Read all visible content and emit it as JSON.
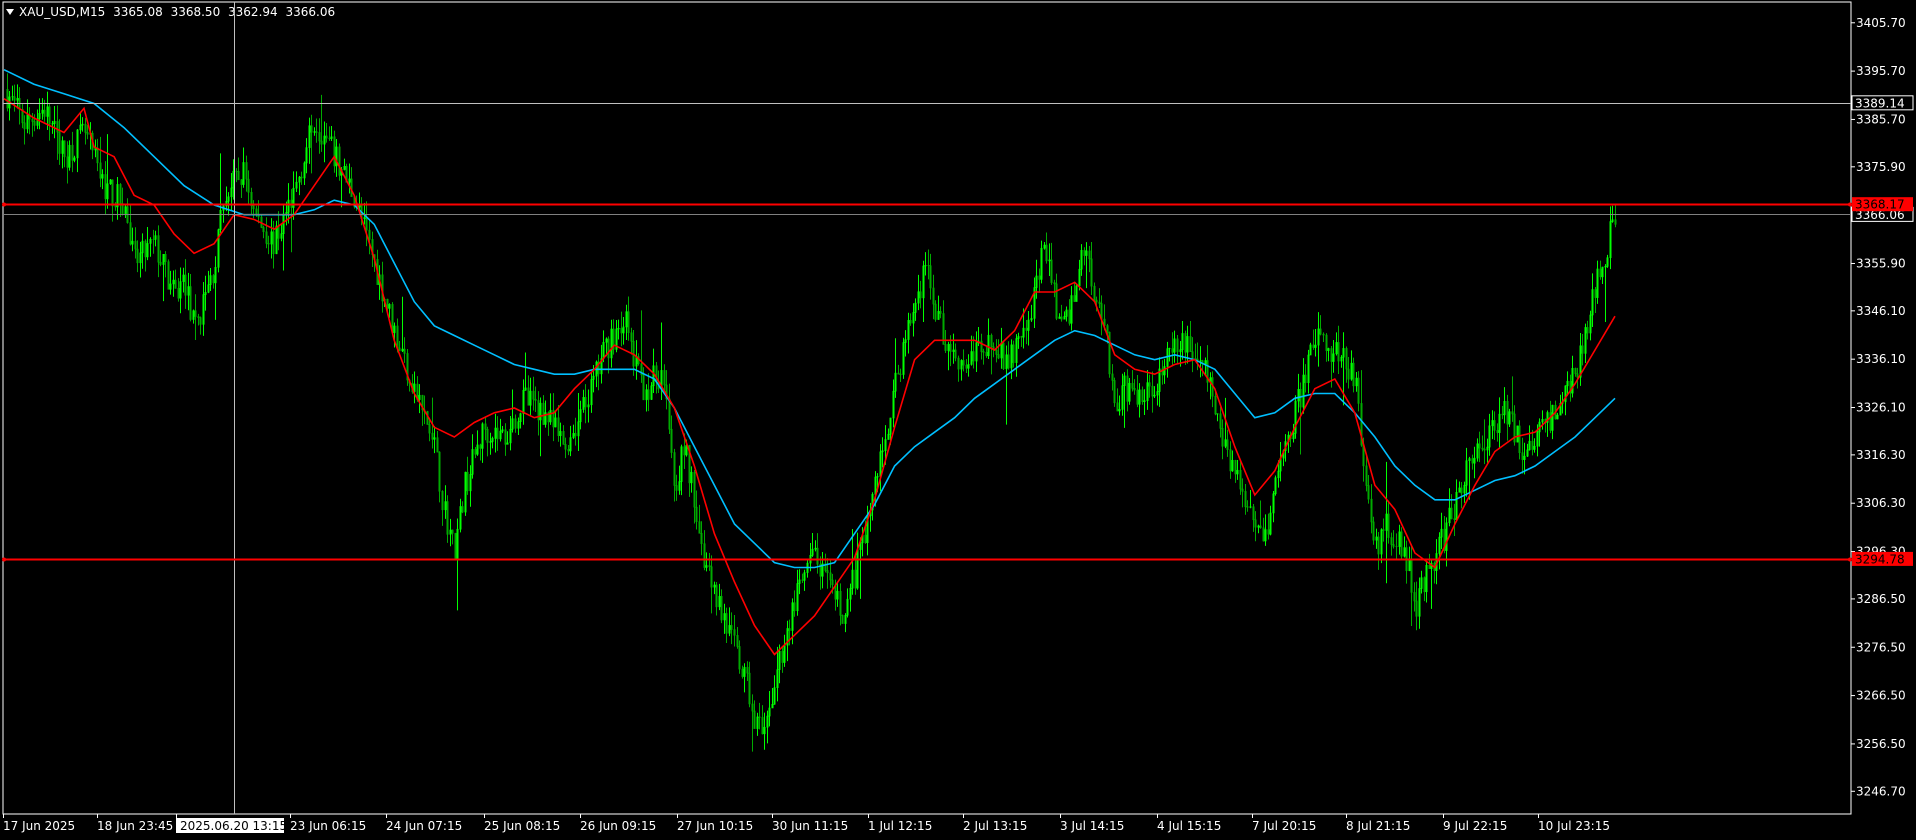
{
  "header": {
    "symbol": "XAU_USD,M15",
    "open": "3365.08",
    "high": "3368.50",
    "low": "3362.94",
    "close": "3366.06"
  },
  "colors": {
    "background": "#000000",
    "bull_candle": "#00ff00",
    "bear_candle": "#00aa00",
    "ma_fast": "#ff0000",
    "ma_slow": "#00bfff",
    "hline": "#ff0000",
    "axis": "#ffffff",
    "crosshair": "#c0c0c0"
  },
  "chart_data": {
    "type": "candlestick",
    "symbol": "XAU_USD",
    "timeframe": "M15",
    "ylim": [
      3242.0,
      3410.0
    ],
    "y_ticks": [
      "3405.70",
      "3395.70",
      "3385.70",
      "3375.90",
      "3366.10",
      "3355.90",
      "3346.10",
      "3336.10",
      "3326.10",
      "3316.30",
      "3306.30",
      "3296.30",
      "3286.50",
      "3276.50",
      "3266.50",
      "3256.50",
      "3246.70"
    ],
    "x_ticks": [
      "17 Jun 2025",
      "18 Jun 23:45",
      "2025.06.20 13:15",
      "23 Jun 06:15",
      "24 Jun 07:15",
      "25 Jun 08:15",
      "26 Jun 09:15",
      "27 Jun 10:15",
      "30 Jun 11:15",
      "1 Jul 12:15",
      "2 Jul 13:15",
      "3 Jul 14:15",
      "4 Jul 15:15",
      "7 Jul 20:15",
      "8 Jul 21:15",
      "9 Jul 22:15",
      "10 Jul 23:15"
    ],
    "price_path": [
      [
        0,
        3392
      ],
      [
        2,
        3385
      ],
      [
        4,
        3388
      ],
      [
        6,
        3378
      ],
      [
        8,
        3383
      ],
      [
        10,
        3372
      ],
      [
        12,
        3368
      ],
      [
        13,
        3356
      ],
      [
        15,
        3360
      ],
      [
        17,
        3349
      ],
      [
        18,
        3353
      ],
      [
        19,
        3342
      ],
      [
        21,
        3355
      ],
      [
        22,
        3370
      ],
      [
        24,
        3375
      ],
      [
        25,
        3366
      ],
      [
        27,
        3360
      ],
      [
        29,
        3371
      ],
      [
        31,
        3386
      ],
      [
        33,
        3378
      ],
      [
        35,
        3370
      ],
      [
        37,
        3356
      ],
      [
        39,
        3342
      ],
      [
        41,
        3330
      ],
      [
        43,
        3318
      ],
      [
        44,
        3305
      ],
      [
        45,
        3296
      ],
      [
        46,
        3310
      ],
      [
        48,
        3322
      ],
      [
        50,
        3320
      ],
      [
        52,
        3328
      ],
      [
        54,
        3325
      ],
      [
        56,
        3318
      ],
      [
        58,
        3326
      ],
      [
        60,
        3338
      ],
      [
        62,
        3345
      ],
      [
        63,
        3335
      ],
      [
        64,
        3330
      ],
      [
        66,
        3334
      ],
      [
        67,
        3310
      ],
      [
        68,
        3318
      ],
      [
        70,
        3295
      ],
      [
        72,
        3282
      ],
      [
        74,
        3270
      ],
      [
        75,
        3262
      ],
      [
        76,
        3257
      ],
      [
        77,
        3270
      ],
      [
        79,
        3286
      ],
      [
        81,
        3296
      ],
      [
        82,
        3290
      ],
      [
        84,
        3283
      ],
      [
        86,
        3300
      ],
      [
        88,
        3320
      ],
      [
        90,
        3340
      ],
      [
        92,
        3355
      ],
      [
        94,
        3340
      ],
      [
        96,
        3335
      ],
      [
        98,
        3340
      ],
      [
        100,
        3336
      ],
      [
        102,
        3340
      ],
      [
        104,
        3360
      ],
      [
        105,
        3348
      ],
      [
        106,
        3342
      ],
      [
        108,
        3360
      ],
      [
        109,
        3350
      ],
      [
        110,
        3344
      ],
      [
        111,
        3325
      ],
      [
        112,
        3330
      ],
      [
        114,
        3328
      ],
      [
        116,
        3335
      ],
      [
        118,
        3340
      ],
      [
        120,
        3334
      ],
      [
        122,
        3318
      ],
      [
        124,
        3308
      ],
      [
        126,
        3300
      ],
      [
        127,
        3310
      ],
      [
        129,
        3325
      ],
      [
        131,
        3340
      ],
      [
        133,
        3338
      ],
      [
        135,
        3332
      ],
      [
        136,
        3312
      ],
      [
        137,
        3296
      ],
      [
        138,
        3302
      ],
      [
        140,
        3296
      ],
      [
        141,
        3285
      ],
      [
        142,
        3290
      ],
      [
        144,
        3300
      ],
      [
        146,
        3313
      ],
      [
        148,
        3320
      ],
      [
        150,
        3326
      ],
      [
        152,
        3316
      ],
      [
        154,
        3323
      ],
      [
        156,
        3328
      ],
      [
        158,
        3340
      ],
      [
        159,
        3352
      ],
      [
        160,
        3358
      ],
      [
        161,
        3366
      ]
    ],
    "ma_fast": [
      [
        0,
        3390
      ],
      [
        3,
        3386
      ],
      [
        6,
        3383
      ],
      [
        8,
        3388
      ],
      [
        9,
        3380
      ],
      [
        11,
        3378
      ],
      [
        13,
        3370
      ],
      [
        15,
        3368
      ],
      [
        17,
        3362
      ],
      [
        19,
        3358
      ],
      [
        21,
        3360
      ],
      [
        23,
        3366
      ],
      [
        25,
        3365
      ],
      [
        27,
        3363
      ],
      [
        29,
        3366
      ],
      [
        31,
        3372
      ],
      [
        33,
        3378
      ],
      [
        35,
        3370
      ],
      [
        37,
        3357
      ],
      [
        39,
        3340
      ],
      [
        41,
        3329
      ],
      [
        43,
        3322
      ],
      [
        45,
        3320
      ],
      [
        47,
        3323
      ],
      [
        49,
        3325
      ],
      [
        51,
        3326
      ],
      [
        53,
        3324
      ],
      [
        55,
        3325
      ],
      [
        57,
        3330
      ],
      [
        59,
        3334
      ],
      [
        61,
        3339
      ],
      [
        63,
        3337
      ],
      [
        65,
        3333
      ],
      [
        67,
        3326
      ],
      [
        69,
        3314
      ],
      [
        71,
        3300
      ],
      [
        73,
        3290
      ],
      [
        75,
        3281
      ],
      [
        76,
        3278
      ],
      [
        77,
        3275
      ],
      [
        79,
        3279
      ],
      [
        81,
        3283
      ],
      [
        83,
        3289
      ],
      [
        85,
        3295
      ],
      [
        87,
        3307
      ],
      [
        89,
        3322
      ],
      [
        91,
        3336
      ],
      [
        93,
        3340
      ],
      [
        95,
        3340
      ],
      [
        97,
        3340
      ],
      [
        99,
        3338
      ],
      [
        101,
        3342
      ],
      [
        103,
        3350
      ],
      [
        105,
        3350
      ],
      [
        107,
        3352
      ],
      [
        109,
        3348
      ],
      [
        111,
        3337
      ],
      [
        113,
        3334
      ],
      [
        115,
        3333
      ],
      [
        117,
        3335
      ],
      [
        119,
        3336
      ],
      [
        121,
        3330
      ],
      [
        123,
        3318
      ],
      [
        125,
        3308
      ],
      [
        127,
        3313
      ],
      [
        129,
        3322
      ],
      [
        131,
        3330
      ],
      [
        133,
        3332
      ],
      [
        135,
        3325
      ],
      [
        137,
        3310
      ],
      [
        139,
        3305
      ],
      [
        141,
        3296
      ],
      [
        143,
        3293
      ],
      [
        145,
        3302
      ],
      [
        147,
        3310
      ],
      [
        149,
        3317
      ],
      [
        151,
        3320
      ],
      [
        153,
        3321
      ],
      [
        155,
        3325
      ],
      [
        157,
        3331
      ],
      [
        159,
        3338
      ],
      [
        161,
        3345
      ]
    ],
    "ma_slow": [
      [
        0,
        3396
      ],
      [
        3,
        3393
      ],
      [
        6,
        3391
      ],
      [
        9,
        3389
      ],
      [
        12,
        3384
      ],
      [
        15,
        3378
      ],
      [
        18,
        3372
      ],
      [
        21,
        3368
      ],
      [
        24,
        3366
      ],
      [
        27,
        3366
      ],
      [
        29,
        3366
      ],
      [
        31,
        3367
      ],
      [
        33,
        3369
      ],
      [
        35,
        3368
      ],
      [
        37,
        3364
      ],
      [
        39,
        3356
      ],
      [
        41,
        3348
      ],
      [
        43,
        3343
      ],
      [
        45,
        3341
      ],
      [
        47,
        3339
      ],
      [
        49,
        3337
      ],
      [
        51,
        3335
      ],
      [
        53,
        3334
      ],
      [
        55,
        3333
      ],
      [
        57,
        3333
      ],
      [
        59,
        3334
      ],
      [
        61,
        3334
      ],
      [
        63,
        3334
      ],
      [
        65,
        3332
      ],
      [
        67,
        3326
      ],
      [
        69,
        3318
      ],
      [
        71,
        3310
      ],
      [
        73,
        3302
      ],
      [
        75,
        3298
      ],
      [
        77,
        3294
      ],
      [
        79,
        3293
      ],
      [
        81,
        3293
      ],
      [
        83,
        3294
      ],
      [
        85,
        3300
      ],
      [
        87,
        3306
      ],
      [
        89,
        3314
      ],
      [
        91,
        3318
      ],
      [
        93,
        3321
      ],
      [
        95,
        3324
      ],
      [
        97,
        3328
      ],
      [
        99,
        3331
      ],
      [
        101,
        3334
      ],
      [
        103,
        3337
      ],
      [
        105,
        3340
      ],
      [
        107,
        3342
      ],
      [
        109,
        3341
      ],
      [
        111,
        3339
      ],
      [
        113,
        3337
      ],
      [
        115,
        3336
      ],
      [
        117,
        3337
      ],
      [
        119,
        3336
      ],
      [
        121,
        3334
      ],
      [
        123,
        3329
      ],
      [
        125,
        3324
      ],
      [
        127,
        3325
      ],
      [
        129,
        3328
      ],
      [
        131,
        3329
      ],
      [
        133,
        3329
      ],
      [
        135,
        3325
      ],
      [
        137,
        3320
      ],
      [
        139,
        3314
      ],
      [
        141,
        3310
      ],
      [
        143,
        3307
      ],
      [
        145,
        3307
      ],
      [
        147,
        3309
      ],
      [
        149,
        3311
      ],
      [
        151,
        3312
      ],
      [
        153,
        3314
      ],
      [
        155,
        3317
      ],
      [
        157,
        3320
      ],
      [
        159,
        3324
      ],
      [
        161,
        3328
      ]
    ],
    "horizontal_lines": [
      {
        "price": 3368.17,
        "label": "3368.17",
        "color": "#ff0000"
      },
      {
        "price": 3294.78,
        "label": "3294.78",
        "color": "#ff0000"
      }
    ],
    "price_labels": [
      {
        "price": 3389.14,
        "label": "3389.14"
      },
      {
        "price": 3366.06,
        "label": "3366.06"
      }
    ],
    "crosshair": {
      "price": 3389.14,
      "x_index": 23,
      "x_label": "2025.06.20 13:15"
    }
  }
}
